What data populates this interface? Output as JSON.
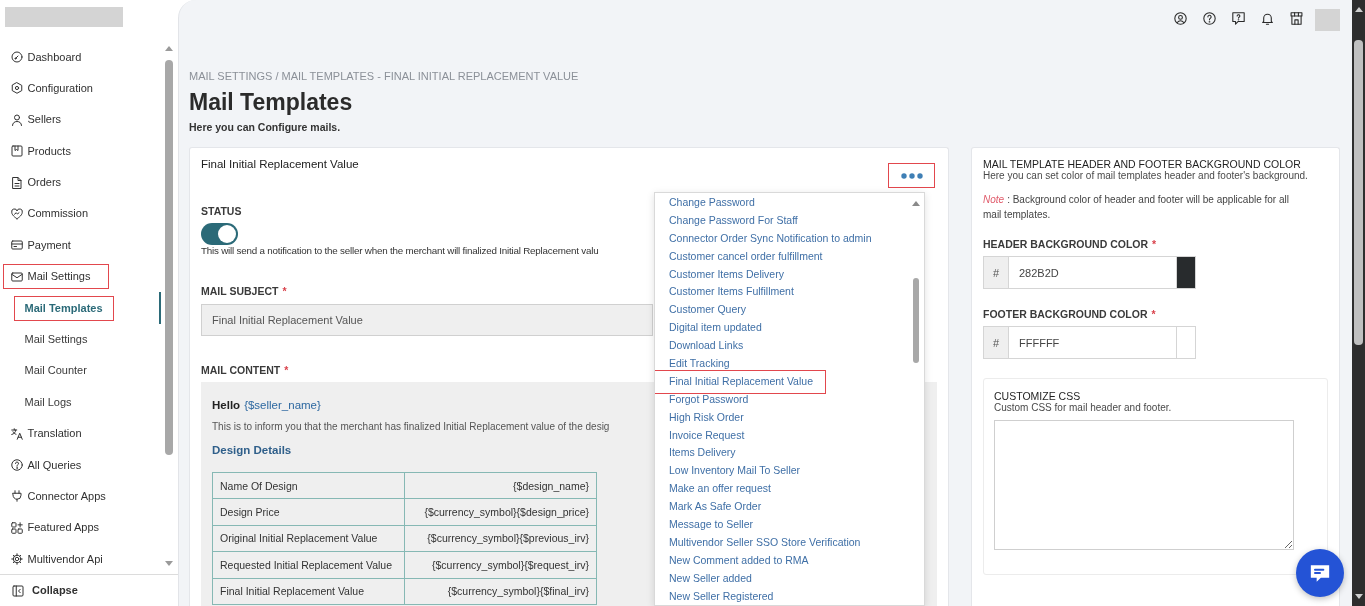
{
  "sidebar": {
    "items": [
      {
        "label": "Dashboard",
        "selected": false,
        "highlighted": false
      },
      {
        "label": "Configuration",
        "selected": false,
        "highlighted": false
      },
      {
        "label": "Sellers",
        "selected": false,
        "highlighted": false
      },
      {
        "label": "Products",
        "selected": false,
        "highlighted": false
      },
      {
        "label": "Orders",
        "selected": false,
        "highlighted": false
      },
      {
        "label": "Commission",
        "selected": false,
        "highlighted": false
      },
      {
        "label": "Payment",
        "selected": false,
        "highlighted": false
      },
      {
        "label": "Mail Settings",
        "selected": false,
        "highlighted": true,
        "children": [
          {
            "label": "Mail Templates",
            "selected": true,
            "highlighted": true
          },
          {
            "label": "Mail Settings",
            "selected": false,
            "highlighted": false
          },
          {
            "label": "Mail Counter",
            "selected": false,
            "highlighted": false
          },
          {
            "label": "Mail Logs",
            "selected": false,
            "highlighted": false
          }
        ]
      },
      {
        "label": "Translation",
        "selected": false,
        "highlighted": false
      },
      {
        "label": "All Queries",
        "selected": false,
        "highlighted": false
      },
      {
        "label": "Connector Apps",
        "selected": false,
        "highlighted": false
      },
      {
        "label": "Featured Apps",
        "selected": false,
        "highlighted": false
      },
      {
        "label": "Multivendor Api",
        "selected": false,
        "highlighted": false
      }
    ],
    "collapse": {
      "label": "Collapse"
    }
  },
  "page": {
    "breadcrumb": "MAIL SETTINGS / MAIL TEMPLATES - FINAL INITIAL REPLACEMENT VALUE",
    "title": "Mail Templates",
    "subtitle": "Here you can Configure mails."
  },
  "template_card": {
    "title": "Final Initial Replacement Value",
    "more_button": {
      "highlighted": true
    },
    "status": {
      "label": "STATUS",
      "on": true,
      "description": "This will send a notification to the seller when the merchant will finalized Initial Replacement valu"
    },
    "mail_subject": {
      "label": "MAIL SUBJECT",
      "required_mark": "*",
      "value": "Final Initial Replacement Value"
    },
    "mail_content": {
      "label": "MAIL CONTENT",
      "required_mark": "*",
      "greeting": "Hello",
      "greeting_variable": "{$seller_name}",
      "intro": "This is to inform you that the merchant has finalized Initial Replacement value of the desig",
      "section_title": "Design Details",
      "table": {
        "rows": [
          [
            "Name Of Design",
            "{$design_name}"
          ],
          [
            "Design Price",
            "{$currency_symbol}{$design_price}"
          ],
          [
            "Original Initial Replacement Value",
            "{$currency_symbol}{$previous_irv}"
          ],
          [
            "Requested Initial Replacement Value",
            "{$currency_symbol}{$request_irv}"
          ],
          [
            "Final Initial Replacement Value",
            "{$currency_symbol}{$final_irv}"
          ]
        ]
      }
    }
  },
  "template_menu": {
    "items": [
      {
        "label": "Change Password",
        "highlighted": false
      },
      {
        "label": "Change Password For Staff",
        "highlighted": false
      },
      {
        "label": "Connector Order Sync Notification to admin",
        "highlighted": false
      },
      {
        "label": "Customer cancel order fulfillment",
        "highlighted": false
      },
      {
        "label": "Customer Items Delivery",
        "highlighted": false
      },
      {
        "label": "Customer Items Fulfillment",
        "highlighted": false
      },
      {
        "label": "Customer Query",
        "highlighted": false
      },
      {
        "label": "Digital item updated",
        "highlighted": false
      },
      {
        "label": "Download Links",
        "highlighted": false
      },
      {
        "label": "Edit Tracking",
        "highlighted": false
      },
      {
        "label": "Final Initial Replacement Value",
        "highlighted": true
      },
      {
        "label": "Forgot Password",
        "highlighted": false
      },
      {
        "label": "High Risk Order",
        "highlighted": false
      },
      {
        "label": "Invoice Request",
        "highlighted": false
      },
      {
        "label": "Items Delivery",
        "highlighted": false
      },
      {
        "label": "Low Inventory Mail To Seller",
        "highlighted": false
      },
      {
        "label": "Make an offer request",
        "highlighted": false
      },
      {
        "label": "Mark As Safe Order",
        "highlighted": false
      },
      {
        "label": "Message to Seller",
        "highlighted": false
      },
      {
        "label": "Multivendor Seller SSO Store Verification",
        "highlighted": false
      },
      {
        "label": "New Comment added to RMA",
        "highlighted": false
      },
      {
        "label": "New Seller added",
        "highlighted": false
      },
      {
        "label": "New Seller Registered",
        "highlighted": false
      }
    ]
  },
  "color_panel": {
    "title": "MAIL TEMPLATE HEADER AND FOOTER BACKGROUND COLOR",
    "description": "Here you can set color of mail templates header and footer's background.",
    "note_label": "Note",
    "note_text": ": Background color of header and footer will be applicable for all mail templates.",
    "color_fields": [
      {
        "label": "HEADER BACKGROUND COLOR",
        "required_mark": "*",
        "prefix": "#",
        "value": "282B2D"
      },
      {
        "label": "FOOTER BACKGROUND COLOR",
        "required_mark": "*",
        "prefix": "#",
        "value": "FFFFFF"
      }
    ],
    "custom_css": {
      "title": "CUSTOMIZE CSS",
      "description": "Custom CSS for mail header and footer."
    }
  }
}
